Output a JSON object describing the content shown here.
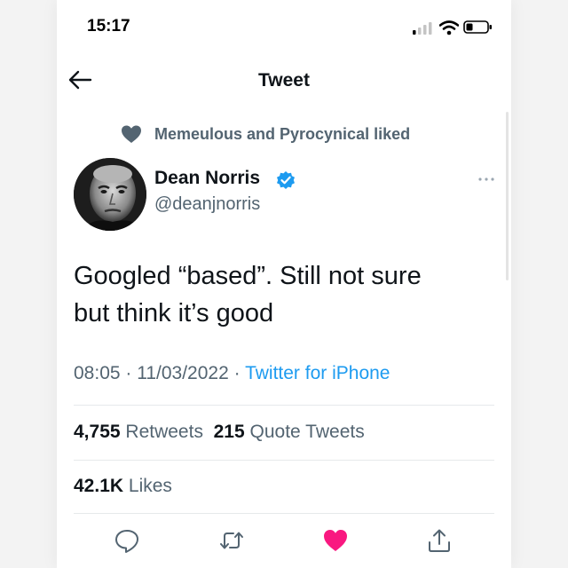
{
  "status_bar": {
    "time": "15:17",
    "icons": [
      "signal-icon",
      "wifi-icon",
      "battery-icon"
    ]
  },
  "nav": {
    "title": "Tweet",
    "back_icon": "back-arrow-icon"
  },
  "social_context": {
    "icon": "heart-icon",
    "text": "Memeulous and Pyrocynical liked"
  },
  "author": {
    "name": "Dean Norris",
    "handle": "@deanjnorris",
    "verified": true,
    "avatar": "avatar-photo"
  },
  "tweet": {
    "text_line1": "Googled “based”. Still not sure",
    "text_line2": "but think it’s good",
    "time": "08:05",
    "date": "11/03/2022",
    "source": "Twitter for iPhone"
  },
  "stats": {
    "retweets_count": "4,755",
    "retweets_label": "Retweets",
    "quotes_count": "215",
    "quotes_label": "Quote Tweets",
    "likes_count": "42.1K",
    "likes_label": "Likes"
  },
  "actions": [
    "reply-icon",
    "retweet-icon",
    "like-icon",
    "share-icon"
  ],
  "colors": {
    "accent": "#1d9bf0",
    "like": "#f91880",
    "secondary_text": "#536471",
    "primary_text": "#0f1419"
  }
}
